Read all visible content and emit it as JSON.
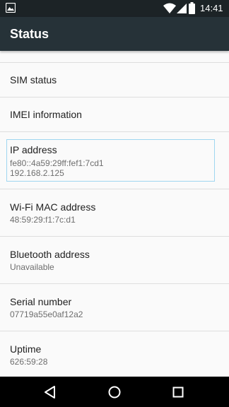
{
  "status_bar": {
    "time": "14:41",
    "icons": [
      "image-notification-icon",
      "wifi-icon",
      "cell-signal-icon",
      "battery-icon"
    ]
  },
  "toolbar": {
    "title": "Status",
    "background": "#263238"
  },
  "items": [
    {
      "label": "SIM status"
    },
    {
      "label": "IMEI information"
    },
    {
      "label": "IP address",
      "value": "fe80::4a59:29ff:fef1:7cd1\n192.168.2.125",
      "focused": true
    },
    {
      "label": "Wi-Fi MAC address",
      "value": "48:59:29:f1:7c:d1"
    },
    {
      "label": "Bluetooth address",
      "value": "Unavailable"
    },
    {
      "label": "Serial number",
      "value": "07719a55e0af12a2"
    },
    {
      "label": "Uptime",
      "value": "626:59:28"
    }
  ],
  "nav_bar": {
    "buttons": [
      "back-icon",
      "home-icon",
      "recents-icon"
    ]
  },
  "colors": {
    "status_bar": "#1c2326",
    "list_background": "#fafafa",
    "focus_outline": "#9fd6f0"
  }
}
